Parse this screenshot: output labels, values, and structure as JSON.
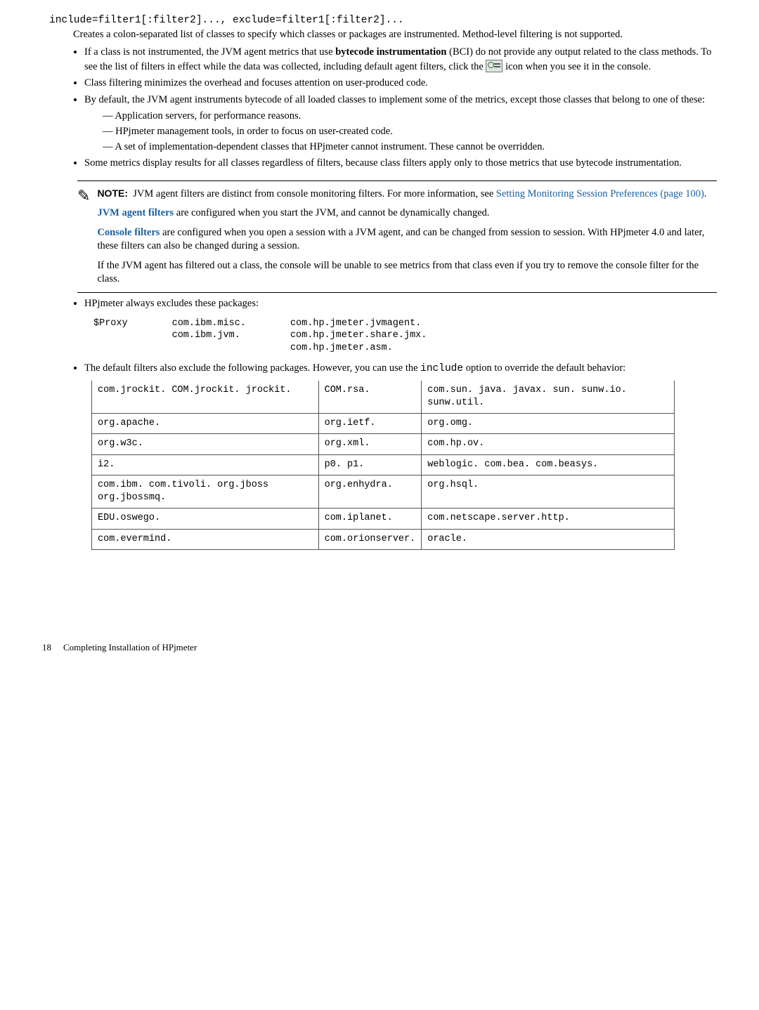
{
  "syntax_line": "include=filter1[:filter2]..., exclude=filter1[:filter2]...",
  "desc_para": "Creates a colon-separated list of classes to specify which classes or packages are instrumented. Method-level filtering is not supported.",
  "bullet1_pre": "If a class is not instrumented, the JVM agent metrics that use ",
  "bullet1_bold": "bytecode instrumentation",
  "bullet1_post": " (BCI) do not provide any output related to the class methods. To see the list of filters in effect while the data was collected, including default agent filters, click the ",
  "bullet1_tail": " icon when you see it in the console.",
  "bullet2": "Class filtering minimizes the overhead and focuses attention on user-produced code.",
  "bullet3": "By default, the JVM agent instruments bytecode of all loaded classes to implement some of the metrics, except those classes that belong to one of these:",
  "dash1": "Application servers, for performance reasons.",
  "dash2": "HPjmeter management tools, in order to focus on user-created code.",
  "dash3": "A set of implementation-dependent classes that HPjmeter cannot instrument. These cannot be overridden.",
  "bullet4": "Some metrics display results for all classes regardless of filters, because class filters apply only to those metrics that use bytecode instrumentation.",
  "note_label": "NOTE:",
  "note1_a": "JVM agent filters are distinct from console monitoring filters. For more information, see ",
  "note1_link": "Setting Monitoring Session Preferences (page 100)",
  "note1_b": ".",
  "note2_bold": "JVM agent filters",
  "note2_rest": " are configured when you start the JVM, and cannot be dynamically changed.",
  "note3_bold": "Console filters",
  "note3_rest": " are configured when you open a session with a JVM agent, and can be changed from session to session. With HPjmeter 4.0 and later, these filters can also be changed during a session.",
  "note4": "If the JVM agent has filtered out a class, the console will be unable to see metrics from that class even if you try to remove the console filter for the class.",
  "bullet5": "HPjmeter always excludes these packages:",
  "excl_c1": "$Proxy",
  "excl_c2a": "com.ibm.misc.",
  "excl_c2b": "com.ibm.jvm.",
  "excl_c3a": "com.hp.jmeter.jvmagent.",
  "excl_c3b": "com.hp.jmeter.share.jmx.",
  "excl_c3c": "com.hp.jmeter.asm.",
  "bullet6_a": "The default filters also exclude the following packages. However, you can use the ",
  "bullet6_mono": "include",
  "bullet6_b": " option to override the default behavior:",
  "grid": {
    "r1": [
      "com.jrockit. COM.jrockit. jrockit.",
      "COM.rsa.",
      "com.sun. java. javax. sun. sunw.io. sunw.util."
    ],
    "r2": [
      "org.apache.",
      "org.ietf.",
      "org.omg."
    ],
    "r3": [
      "org.w3c.",
      "org.xml.",
      "com.hp.ov."
    ],
    "r4": [
      "i2.",
      "p0. p1.",
      "weblogic. com.bea. com.beasys."
    ],
    "r5": [
      "com.ibm. com.tivoli. org.jboss org.jbossmq.",
      "org.enhydra.",
      "org.hsql."
    ],
    "r6": [
      "EDU.oswego.",
      "com.iplanet.",
      "com.netscape.server.http."
    ],
    "r7": [
      "com.evermind.",
      "com.orionserver.",
      "oracle."
    ]
  },
  "footer_page": "18",
  "footer_title": "Completing Installation of HPjmeter"
}
